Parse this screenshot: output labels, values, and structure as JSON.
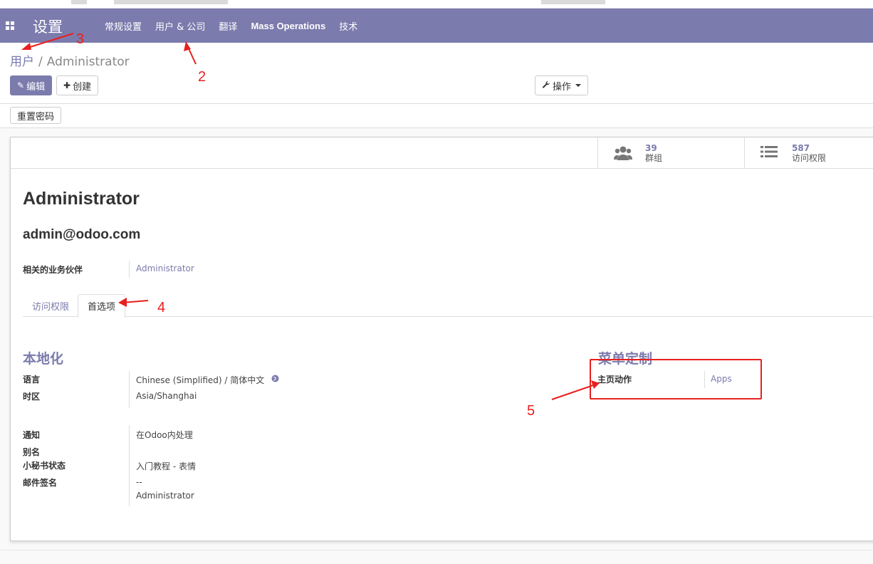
{
  "navbar": {
    "brand": "设置",
    "menu": [
      "常规设置",
      "用户 & 公司",
      "翻译",
      "Mass Operations",
      "技术"
    ]
  },
  "breadcrumb": {
    "parent": "用户",
    "separator": "/",
    "current": "Administrator"
  },
  "toolbar": {
    "edit_label": "编辑",
    "create_label": "创建",
    "action_label": "操作"
  },
  "statusbar": {
    "reset_password_label": "重置密码"
  },
  "stats": {
    "groups": {
      "value": "39",
      "label": "群组",
      "icon": "users-icon"
    },
    "access_rights": {
      "value": "587",
      "label": "访问权限",
      "icon": "list-icon"
    }
  },
  "record": {
    "name": "Administrator",
    "login": "admin@odoo.com",
    "related_partner_label": "相关的业务伙伴",
    "related_partner_value": "Administrator"
  },
  "tabs": [
    "访问权限",
    "首选项"
  ],
  "localization": {
    "title": "本地化",
    "language_label": "语言",
    "language_value": "Chinese (Simplified) / 简体中文",
    "timezone_label": "时区",
    "timezone_value": "Asia/Shanghai",
    "notification_label": "通知",
    "notification_value": "在Odoo内处理",
    "alias_label": "别名",
    "odoobot_label": "小秘书状态",
    "odoobot_value": "入门教程 - 表情",
    "signature_label": "邮件签名",
    "signature_line1": "--",
    "signature_line2": "Administrator"
  },
  "menu_customization": {
    "title": "菜单定制",
    "home_action_label": "主页动作",
    "home_action_value": "Apps"
  },
  "annotations": [
    "2",
    "3",
    "4",
    "5"
  ],
  "colors": {
    "brand": "#7c7bad",
    "annotation": "#e8201e"
  }
}
